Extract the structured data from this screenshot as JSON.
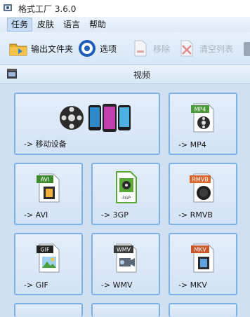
{
  "window": {
    "title": "格式工厂 3.6.0"
  },
  "menu": {
    "items": [
      {
        "label": "任务",
        "active": true
      },
      {
        "label": "皮肤",
        "active": false
      },
      {
        "label": "语言",
        "active": false
      },
      {
        "label": "帮助",
        "active": false
      }
    ]
  },
  "toolbar": {
    "output_folder_label": "输出文件夹",
    "options_label": "选项",
    "remove_label": "移除",
    "clear_list_label": "清空列表",
    "remove_disabled": true,
    "clear_list_disabled": true
  },
  "section": {
    "label": "视频"
  },
  "tiles": [
    {
      "label": "-> 移动设备",
      "icon": "mobile-devices-icon"
    },
    {
      "label": "-> MP4",
      "icon": "mp4-file-icon",
      "badge": "MP4",
      "badge_color": "#4a9a3a"
    },
    {
      "label": "-> AVI",
      "icon": "avi-file-icon",
      "badge": "AVI",
      "badge_color": "#3e8a2c"
    },
    {
      "label": "-> 3GP",
      "icon": "3gp-file-icon",
      "badge": "3GP",
      "badge_color": "#5aa83a"
    },
    {
      "label": "-> RMVB",
      "icon": "rmvb-file-icon",
      "badge": "RMVB",
      "badge_color": "#d9662a"
    },
    {
      "label": "-> GIF",
      "icon": "gif-file-icon",
      "badge": "GIF",
      "badge_color": "#222222"
    },
    {
      "label": "-> WMV",
      "icon": "wmv-file-icon",
      "badge": "WMV",
      "badge_color": "#3a3a3a"
    },
    {
      "label": "-> MKV",
      "icon": "mkv-file-icon",
      "badge": "MKV",
      "badge_color": "#c8552a"
    }
  ],
  "colors": {
    "tile_border": "#7fb0e6",
    "background": "#cfe0f3"
  }
}
